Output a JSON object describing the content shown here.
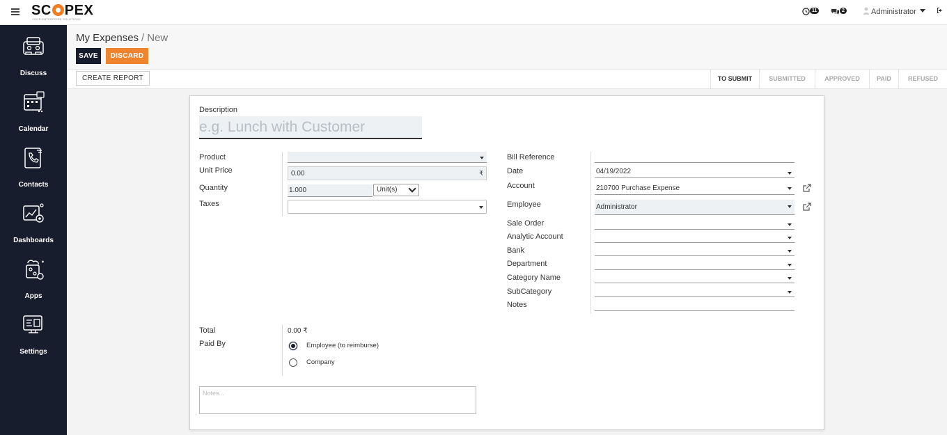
{
  "topbar": {
    "logo": "SCOPEX",
    "logo_left": "SC",
    "logo_right": "PEX",
    "logo_tagline": "YOUR ENTERPRISE SOLUTIONS",
    "activity_count": "11",
    "messages_count": "2",
    "user_name": "Administrator"
  },
  "sidebar": {
    "items": [
      {
        "label": "Discuss",
        "icon": "discuss-icon"
      },
      {
        "label": "Calendar",
        "icon": "calendar-icon"
      },
      {
        "label": "Contacts",
        "icon": "contacts-icon"
      },
      {
        "label": "Dashboards",
        "icon": "dashboards-icon"
      },
      {
        "label": "Apps",
        "icon": "apps-icon"
      },
      {
        "label": "Settings",
        "icon": "settings-icon"
      }
    ]
  },
  "breadcrumb": {
    "parent": "My Expenses",
    "separator": "/",
    "current": "New"
  },
  "buttons": {
    "save": "SAVE",
    "discard": "DISCARD",
    "create_report": "CREATE REPORT"
  },
  "stages": [
    {
      "label": "TO SUBMIT",
      "active": true
    },
    {
      "label": "SUBMITTED",
      "active": false
    },
    {
      "label": "APPROVED",
      "active": false
    },
    {
      "label": "PAID",
      "active": false
    },
    {
      "label": "REFUSED",
      "active": false
    }
  ],
  "form": {
    "description_label": "Description",
    "description_placeholder": "e.g. Lunch with Customer",
    "product_label": "Product",
    "product_value": "",
    "unit_price_label": "Unit Price",
    "unit_price_value": "0.00",
    "currency_symbol": "₹",
    "quantity_label": "Quantity",
    "quantity_value": "1.000",
    "uom_value": "Unit(s)",
    "taxes_label": "Taxes",
    "taxes_value": "",
    "bill_reference_label": "Bill Reference",
    "bill_reference_value": "",
    "date_label": "Date",
    "date_value": "04/19/2022",
    "account_label": "Account",
    "account_value": "210700 Purchase Expense",
    "employee_label": "Employee",
    "employee_value": "Administrator",
    "sale_order_label": "Sale Order",
    "analytic_account_label": "Analytic Account",
    "bank_label": "Bank",
    "department_label": "Department",
    "category_name_label": "Category Name",
    "subcategory_label": "SubCategory",
    "notes_field_label": "Notes",
    "total_label": "Total",
    "total_value": "0.00 ₹",
    "paid_by_label": "Paid By",
    "paid_by_options": [
      {
        "label": "Employee (to reimburse)",
        "selected": true
      },
      {
        "label": "Company",
        "selected": false
      }
    ],
    "notes_placeholder": "Notes..."
  },
  "colors": {
    "sidebar_bg": "#171d2d",
    "save_bg": "#171d2d",
    "discard_bg": "#f0832d",
    "logo_accent": "#f47c20"
  }
}
